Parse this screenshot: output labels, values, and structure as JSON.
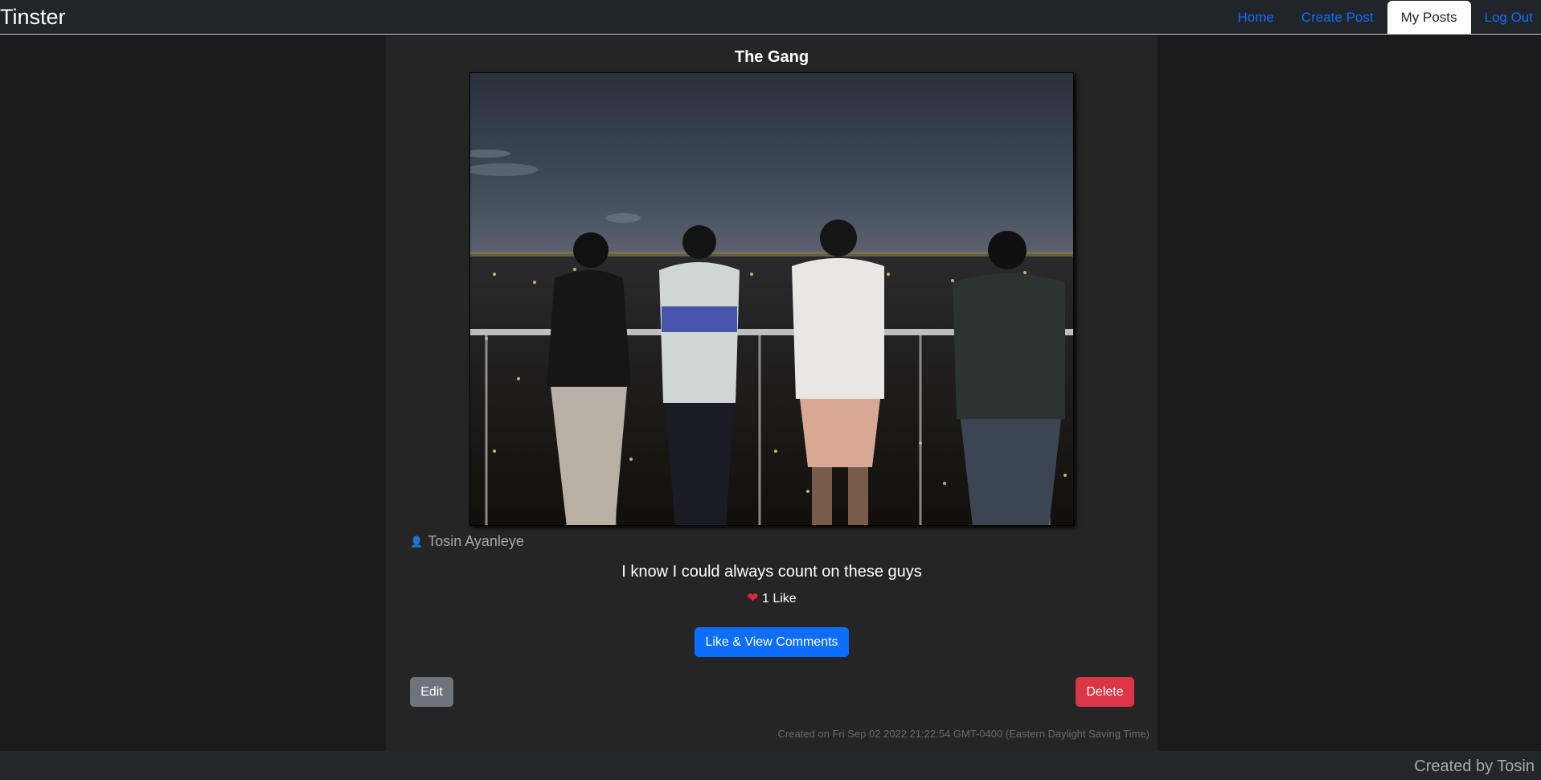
{
  "navbar": {
    "brand": "Tinster",
    "links": [
      {
        "label": "Home",
        "active": false
      },
      {
        "label": "Create Post",
        "active": false
      },
      {
        "label": "My Posts",
        "active": true
      },
      {
        "label": "Log Out",
        "active": false
      }
    ]
  },
  "post": {
    "title": "The Gang",
    "image_icon": "photo-of-four-friends-on-balcony",
    "author": "Tosin Ayanleye",
    "author_icon": "person-icon",
    "caption": "I know I could always count on these guys",
    "likes_icon": "❤️",
    "likes_text": "1 Like",
    "like_button_label": "Like & View Comments",
    "edit_label": "Edit",
    "delete_label": "Delete",
    "created_on": "Created on Fri Sep 02 2022 21:22:54 GMT-0400 (Eastern Daylight Saving Time)"
  },
  "footer": {
    "text": "Created by Tosin"
  },
  "colors": {
    "primary": "#0d6efd",
    "danger": "#dc3545",
    "secondary": "#6c757d",
    "navbar_bg": "#212529",
    "card_bg": "#252525",
    "page_bg": "#1b1b1b"
  }
}
